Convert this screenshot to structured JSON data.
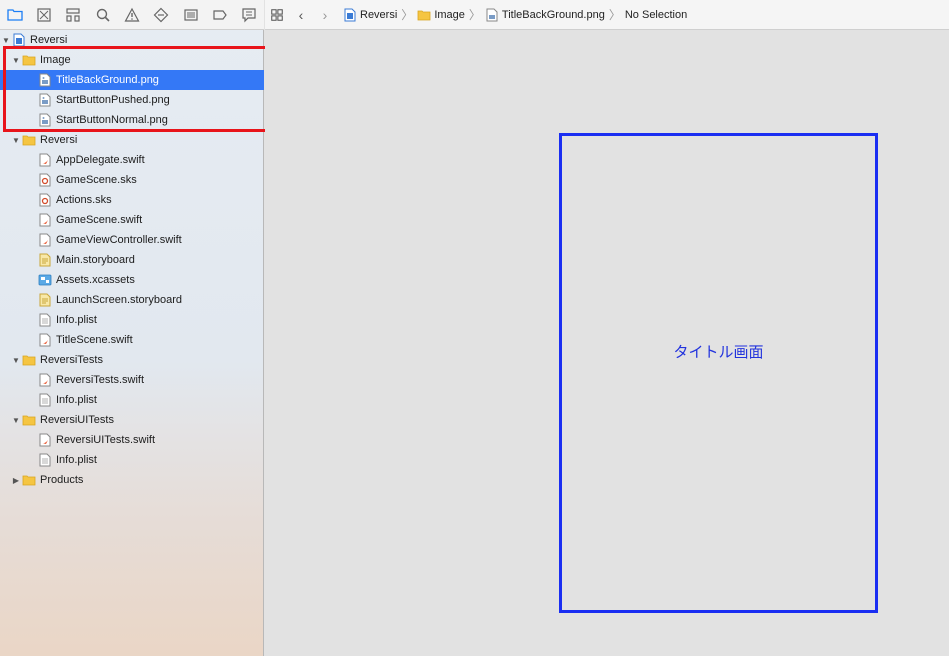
{
  "jumpbar": {
    "crumbs": [
      "Reversi",
      "Image",
      "TitleBackGround.png",
      "No Selection"
    ]
  },
  "navigator": {
    "toolbar_icons": [
      "folder-icon",
      "source-control-icon",
      "hierarchy-icon",
      "search-icon",
      "warning-icon",
      "test-icon",
      "debug-icon",
      "breakpoint-icon",
      "report-icon"
    ],
    "items": [
      {
        "label": "Reversi",
        "type": "project",
        "disclosure": "open",
        "indent": 0
      },
      {
        "label": "Image",
        "type": "folder",
        "disclosure": "open",
        "indent": 1
      },
      {
        "label": "TitleBackGround.png",
        "type": "image",
        "indent": 2,
        "selected": true
      },
      {
        "label": "StartButtonPushed.png",
        "type": "image",
        "indent": 2
      },
      {
        "label": "StartButtonNormal.png",
        "type": "image",
        "indent": 2
      },
      {
        "label": "Reversi",
        "type": "folder",
        "disclosure": "open",
        "indent": 1
      },
      {
        "label": "AppDelegate.swift",
        "type": "swift",
        "indent": 2
      },
      {
        "label": "GameScene.sks",
        "type": "sks",
        "indent": 2
      },
      {
        "label": "Actions.sks",
        "type": "sks",
        "indent": 2
      },
      {
        "label": "GameScene.swift",
        "type": "swift",
        "indent": 2
      },
      {
        "label": "GameViewController.swift",
        "type": "swift",
        "indent": 2
      },
      {
        "label": "Main.storyboard",
        "type": "storyboard",
        "indent": 2
      },
      {
        "label": "Assets.xcassets",
        "type": "assets",
        "indent": 2
      },
      {
        "label": "LaunchScreen.storyboard",
        "type": "storyboard",
        "indent": 2
      },
      {
        "label": "Info.plist",
        "type": "plist",
        "indent": 2
      },
      {
        "label": "TitleScene.swift",
        "type": "swift",
        "indent": 2
      },
      {
        "label": "ReversiTests",
        "type": "folder",
        "disclosure": "open",
        "indent": 1
      },
      {
        "label": "ReversiTests.swift",
        "type": "swift",
        "indent": 2
      },
      {
        "label": "Info.plist",
        "type": "plist",
        "indent": 2
      },
      {
        "label": "ReversiUITests",
        "type": "folder",
        "disclosure": "open",
        "indent": 1
      },
      {
        "label": "ReversiUITests.swift",
        "type": "swift",
        "indent": 2
      },
      {
        "label": "Info.plist",
        "type": "plist",
        "indent": 2
      },
      {
        "label": "Products",
        "type": "folder",
        "disclosure": "closed",
        "indent": 1
      }
    ]
  },
  "canvas": {
    "scene_label": "タイトル画面"
  },
  "colors": {
    "selection": "#3478f6",
    "annotation_red": "#e8141b",
    "annotation_blue": "#1a2ef2",
    "folder": "#f5c542"
  }
}
